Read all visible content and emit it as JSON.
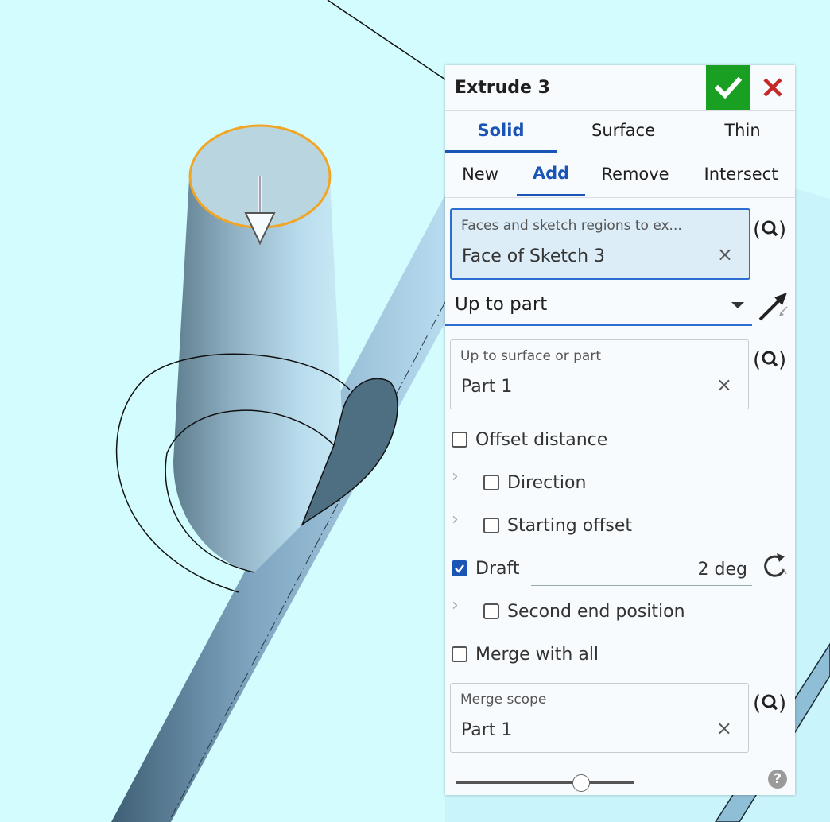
{
  "dialog": {
    "title": "Extrude 3",
    "ok_icon": "checkmark-icon",
    "cancel_icon": "close-icon",
    "accent_color": "#1a54b5",
    "ok_color": "#19a023",
    "cancel_color": "#c62828"
  },
  "tabs": [
    "Solid",
    "Surface",
    "Thin"
  ],
  "active_tab": "Solid",
  "operations": [
    "New",
    "Add",
    "Remove",
    "Intersect"
  ],
  "active_operation": "Add",
  "faces_field": {
    "label": "Faces and sketch regions to ex...",
    "value": "Face of Sketch 3"
  },
  "end_type": {
    "value": "Up to part"
  },
  "up_to_field": {
    "label": "Up to surface or part",
    "value": "Part 1"
  },
  "options": {
    "offset_distance": {
      "label": "Offset distance",
      "checked": false
    },
    "direction": {
      "label": "Direction",
      "checked": false
    },
    "starting_offset": {
      "label": "Starting offset",
      "checked": false
    },
    "draft": {
      "label": "Draft",
      "checked": true,
      "value": "2 deg"
    },
    "second_end_position": {
      "label": "Second end position",
      "checked": false
    },
    "merge_with_all": {
      "label": "Merge with all",
      "checked": false
    }
  },
  "merge_scope_field": {
    "label": "Merge scope",
    "value": "Part 1"
  },
  "clear_glyph": "×",
  "help_glyph": "?",
  "chevron_glyph": "›",
  "slider": {
    "level": 0.7
  }
}
